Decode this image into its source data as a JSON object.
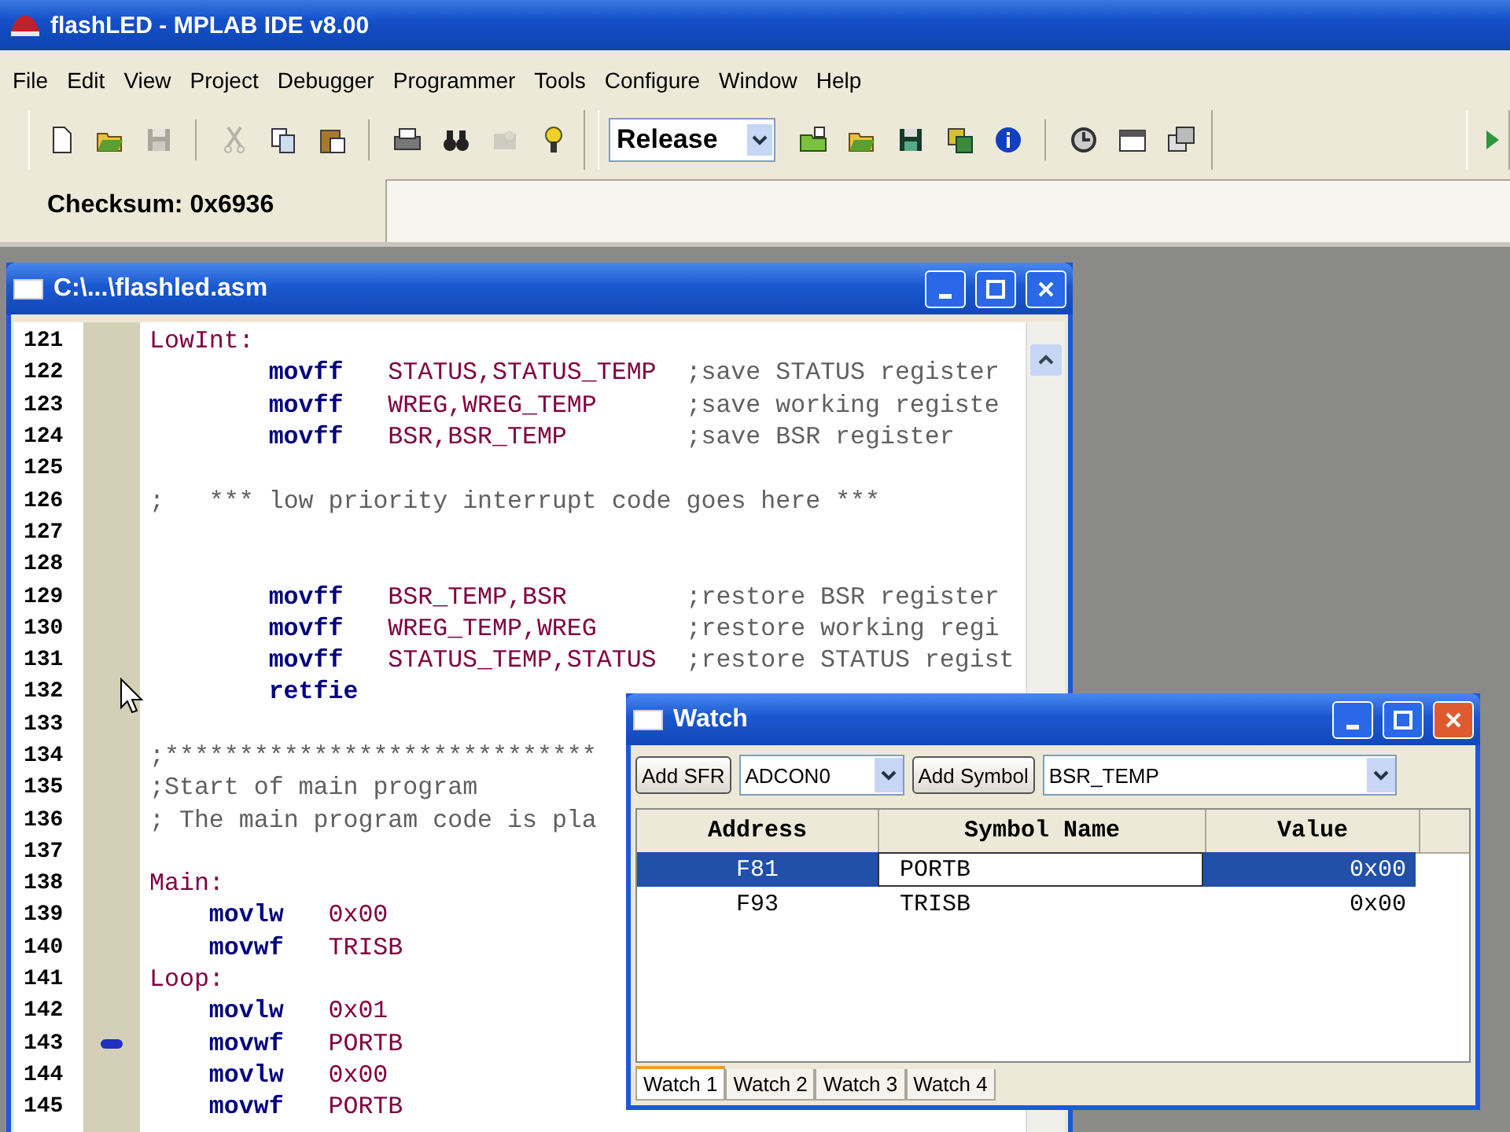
{
  "window": {
    "title": "flashLED - MPLAB IDE v8.00"
  },
  "menu": [
    "File",
    "Edit",
    "View",
    "Project",
    "Debugger",
    "Programmer",
    "Tools",
    "Configure",
    "Window",
    "Help"
  ],
  "toolbar": {
    "groups": [
      [
        {
          "kind": "new",
          "disabled": false
        },
        {
          "kind": "open",
          "disabled": false
        },
        {
          "kind": "save",
          "disabled": true
        }
      ],
      [
        {
          "kind": "cut",
          "disabled": true
        },
        {
          "kind": "copy",
          "disabled": false
        },
        {
          "kind": "paste",
          "disabled": false
        }
      ],
      [
        {
          "kind": "print",
          "disabled": false
        },
        {
          "kind": "find",
          "disabled": false
        },
        {
          "kind": "findfiles",
          "disabled": true
        },
        {
          "kind": "help",
          "disabled": false
        }
      ]
    ],
    "build_config": "Release",
    "project_groups": [
      [
        {
          "kind": "projnew",
          "disabled": false
        },
        {
          "kind": "open",
          "disabled": false
        },
        {
          "kind": "save",
          "disabled": false
        },
        {
          "kind": "build",
          "disabled": false
        },
        {
          "kind": "info",
          "disabled": false
        }
      ],
      [
        {
          "kind": "clock",
          "disabled": false
        },
        {
          "kind": "window",
          "disabled": false
        },
        {
          "kind": "windows",
          "disabled": false
        }
      ]
    ]
  },
  "status": {
    "checksum": "Checksum: 0x6936"
  },
  "editor": {
    "title": "C:\\...\\flashled.asm",
    "lines": [
      {
        "num": "121",
        "kind": "label",
        "text": "LowInt:",
        "marked": false
      },
      {
        "num": "122",
        "kind": "instr",
        "op": "movff",
        "args": "STATUS,STATUS_TEMP",
        "comment": ";save STATUS register",
        "marked": false
      },
      {
        "num": "123",
        "kind": "instr",
        "op": "movff",
        "args": "WREG,WREG_TEMP",
        "comment": ";save working registe",
        "marked": false
      },
      {
        "num": "124",
        "kind": "instr",
        "op": "movff",
        "args": "BSR,BSR_TEMP",
        "comment": ";save BSR register",
        "marked": false
      },
      {
        "num": "125",
        "kind": "blank",
        "marked": false
      },
      {
        "num": "126",
        "kind": "comment",
        "text": ";   *** low priority interrupt code goes here ***",
        "marked": false
      },
      {
        "num": "127",
        "kind": "blank",
        "marked": false
      },
      {
        "num": "128",
        "kind": "blank",
        "marked": false
      },
      {
        "num": "129",
        "kind": "instr",
        "op": "movff",
        "args": "BSR_TEMP,BSR",
        "comment": ";restore BSR register",
        "marked": false
      },
      {
        "num": "130",
        "kind": "instr",
        "op": "movff",
        "args": "WREG_TEMP,WREG",
        "comment": ";restore working regi",
        "marked": false
      },
      {
        "num": "131",
        "kind": "instr",
        "op": "movff",
        "args": "STATUS_TEMP,STATUS",
        "comment": ";restore STATUS regist",
        "marked": false
      },
      {
        "num": "132",
        "kind": "instr",
        "op": "retfie",
        "marked": false
      },
      {
        "num": "133",
        "kind": "blank",
        "marked": false
      },
      {
        "num": "134",
        "kind": "comment",
        "text": ";*****************************",
        "marked": false
      },
      {
        "num": "135",
        "kind": "comment",
        "text": ";Start of main program",
        "marked": false
      },
      {
        "num": "136",
        "kind": "comment",
        "text": "; The main program code is pla",
        "marked": false
      },
      {
        "num": "137",
        "kind": "blank",
        "marked": false
      },
      {
        "num": "138",
        "kind": "label",
        "text": "Main:",
        "marked": false
      },
      {
        "num": "139",
        "kind": "short",
        "op": "movlw",
        "args": "0x00",
        "marked": false
      },
      {
        "num": "140",
        "kind": "short",
        "op": "movwf",
        "args": "TRISB",
        "marked": false
      },
      {
        "num": "141",
        "kind": "label",
        "text": "Loop:",
        "marked": false
      },
      {
        "num": "142",
        "kind": "short",
        "op": "movlw",
        "args": "0x01",
        "marked": false
      },
      {
        "num": "143",
        "kind": "short",
        "op": "movwf",
        "args": "PORTB",
        "marked": true
      },
      {
        "num": "144",
        "kind": "short",
        "op": "movlw",
        "args": "0x00",
        "marked": false
      },
      {
        "num": "145",
        "kind": "short",
        "op": "movwf",
        "args": "PORTB",
        "marked": false
      }
    ]
  },
  "watch": {
    "title": "Watch",
    "add_sfr": "Add SFR",
    "sfr": "ADCON0",
    "add_symbol": "Add Symbol",
    "symbol": "BSR_TEMP",
    "columns": [
      "Address",
      "Symbol Name",
      "Value"
    ],
    "rows": [
      {
        "address": "F81",
        "symbol": "PORTB",
        "value": "0x00",
        "selected": true
      },
      {
        "address": "F93",
        "symbol": "TRISB",
        "value": "0x00",
        "selected": false
      }
    ],
    "tabs": [
      {
        "label": "Watch 1",
        "selected": true
      },
      {
        "label": "Watch 2",
        "selected": false
      },
      {
        "label": "Watch 3",
        "selected": false
      },
      {
        "label": "Watch 4",
        "selected": false
      }
    ]
  }
}
